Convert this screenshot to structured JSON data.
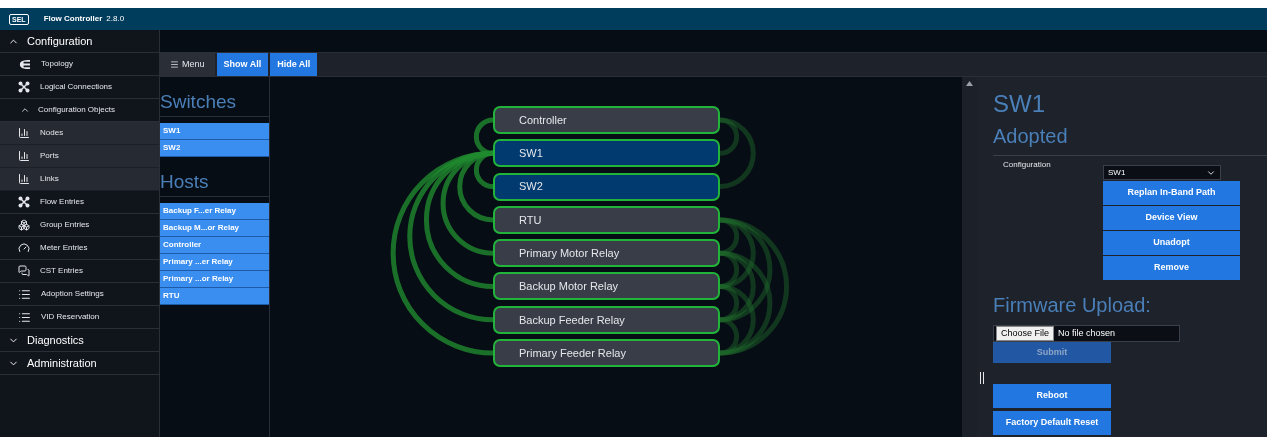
{
  "header": {
    "logo": "SEL",
    "title": "Flow Controller",
    "version": "2.8.0"
  },
  "sidebar": [
    {
      "label": "Configuration",
      "expanded": true,
      "items": [
        {
          "label": "Topology"
        },
        {
          "label": "Logical Connections"
        },
        {
          "label": "Configuration Objects",
          "expanded": true,
          "children": [
            {
              "label": "Nodes"
            },
            {
              "label": "Ports"
            },
            {
              "label": "Links"
            }
          ]
        },
        {
          "label": "Flow Entries"
        },
        {
          "label": "Group Entries"
        },
        {
          "label": "Meter Entries"
        },
        {
          "label": "CST Entries"
        },
        {
          "label": "Adoption Settings"
        },
        {
          "label": "VID Reservation"
        }
      ]
    },
    {
      "label": "Diagnostics",
      "expanded": false
    },
    {
      "label": "Administration",
      "expanded": false
    }
  ],
  "toolbar": {
    "menu": "Menu",
    "buttons": [
      "Show All",
      "Hide All"
    ]
  },
  "lists": [
    {
      "title": "Switches",
      "items": [
        "SW1",
        "SW2"
      ]
    },
    {
      "title": "Hosts",
      "items": [
        "Backup F...er Relay",
        "Backup M...or Relay",
        "Controller",
        "Primary ...er Relay",
        "Primary ...or Relay",
        "RTU"
      ]
    }
  ],
  "diagram": {
    "nodes": [
      {
        "label": "Controller",
        "selected": false
      },
      {
        "label": "SW1",
        "selected": true
      },
      {
        "label": "SW2",
        "selected": true
      },
      {
        "label": "RTU",
        "selected": false
      },
      {
        "label": "Primary Motor Relay",
        "selected": false
      },
      {
        "label": "Backup Motor Relay",
        "selected": false
      },
      {
        "label": "Backup Feeder Relay",
        "selected": false
      },
      {
        "label": "Primary Feeder Relay",
        "selected": false
      }
    ]
  },
  "details": {
    "title": "SW1",
    "status": "Adopted",
    "config_label": "Configuration",
    "select_value": "SW1",
    "actions": [
      "Replan In-Band Path",
      "Device View",
      "Unadopt",
      "Remove"
    ],
    "firmware": {
      "title": "Firmware Upload:",
      "choose": "Choose File",
      "file_status": "No file chosen",
      "submit": {
        "label": "Submit",
        "disabled": true
      }
    },
    "buttons": [
      "Reboot",
      "Factory Default Reset"
    ]
  }
}
